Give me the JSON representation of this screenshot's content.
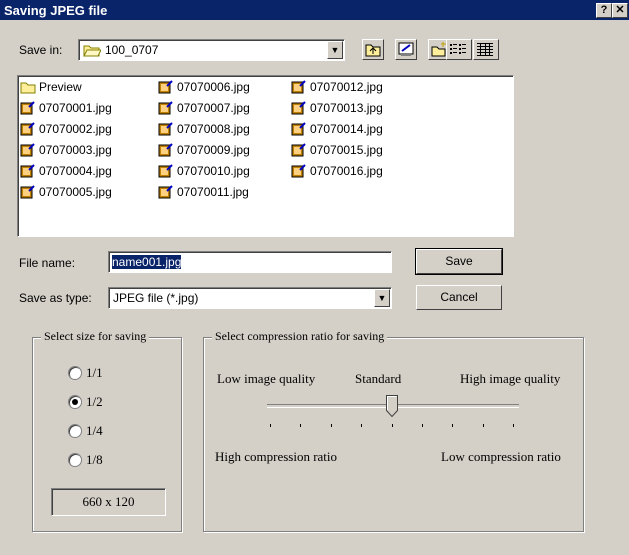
{
  "window": {
    "title": "Saving JPEG file",
    "help_label": "?",
    "close_label": "✕"
  },
  "save_in": {
    "label": "Save in:",
    "value": "100_0707"
  },
  "toolbar": {
    "up_icon": "up-folder-icon",
    "desktop_icon": "desktop-icon",
    "new_folder_icon": "new-folder-icon",
    "list_icon": "list-view-icon",
    "details_icon": "details-view-icon"
  },
  "files": {
    "folder": "Preview",
    "col1": [
      "07070001.jpg",
      "07070002.jpg",
      "07070003.jpg",
      "07070004.jpg",
      "07070005.jpg"
    ],
    "col2": [
      "07070006.jpg",
      "07070007.jpg",
      "07070008.jpg",
      "07070009.jpg",
      "07070010.jpg",
      "07070011.jpg"
    ],
    "col3": [
      "07070012.jpg",
      "07070013.jpg",
      "07070014.jpg",
      "07070015.jpg",
      "07070016.jpg"
    ]
  },
  "file_name": {
    "label": "File name:",
    "value": "name001.jpg"
  },
  "save_type": {
    "label": "Save as type:",
    "value": "JPEG file (*.jpg)"
  },
  "buttons": {
    "save": "Save",
    "cancel": "Cancel"
  },
  "size_group": {
    "title": "Select size for saving",
    "options": [
      "1/1",
      "1/2",
      "1/4",
      "1/8"
    ],
    "selected": "1/2",
    "dimensions": "660 x 120"
  },
  "compression_group": {
    "title": "Select compression ratio for saving",
    "low_quality": "Low image quality",
    "standard": "Standard",
    "high_quality": "High image quality",
    "high_ratio": "High compression ratio",
    "low_ratio": "Low compression ratio",
    "slider_fraction": 0.5,
    "tick_count": 9
  }
}
